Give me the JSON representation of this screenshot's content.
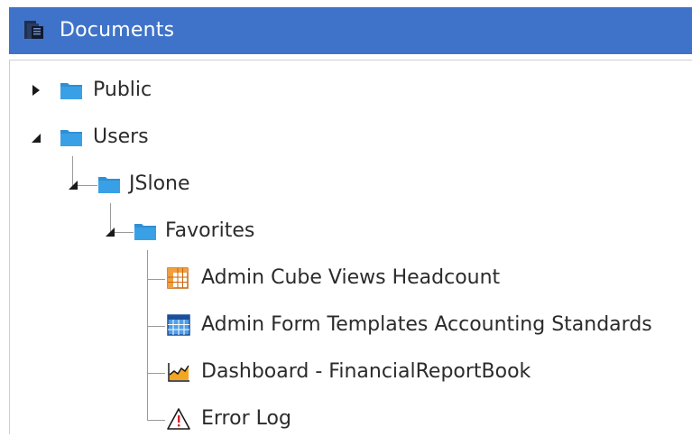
{
  "header": {
    "title": "Documents",
    "icon": "documents-icon"
  },
  "tree": {
    "public": {
      "label": "Public",
      "state": "collapsed"
    },
    "users": {
      "label": "Users",
      "state": "expanded"
    },
    "jslone": {
      "label": "JSlone",
      "state": "expanded"
    },
    "favorites": {
      "label": "Favorites",
      "state": "expanded"
    },
    "items": [
      {
        "label": "Admin Cube Views Headcount",
        "icon": "cube-view-icon"
      },
      {
        "label": "Admin Form Templates Accounting Standards",
        "icon": "form-template-icon"
      },
      {
        "label": "Dashboard - FinancialReportBook",
        "icon": "dashboard-icon"
      },
      {
        "label": "Error Log",
        "icon": "warning-icon"
      }
    ]
  },
  "colors": {
    "header_bg": "#3f73c9",
    "folder": "#2f8fd6",
    "text": "#2b2b2b"
  }
}
